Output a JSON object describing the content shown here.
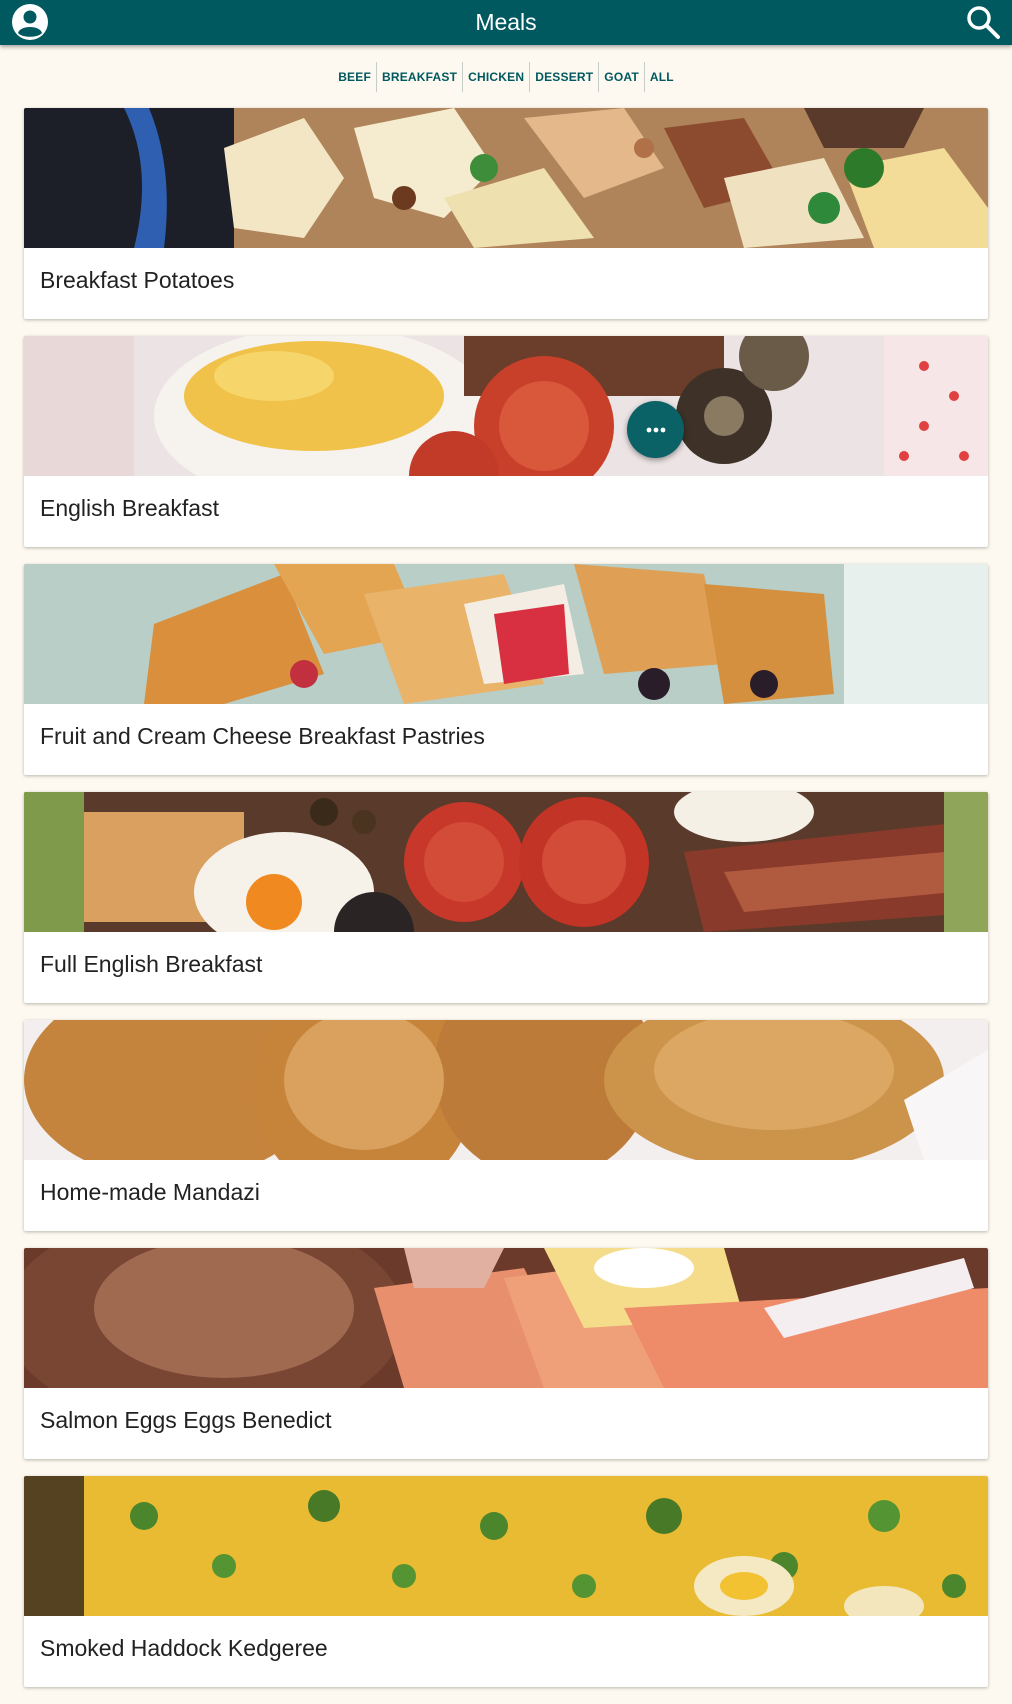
{
  "app": {
    "title": "Meals",
    "primary_color": "#00595f",
    "account_icon": "account-circle-icon",
    "search_icon": "search-icon"
  },
  "categories": [
    "BEEF",
    "BREAKFAST",
    "CHICKEN",
    "DESSERT",
    "GOAT",
    "ALL"
  ],
  "meals": [
    {
      "name": "Breakfast Potatoes"
    },
    {
      "name": "English Breakfast"
    },
    {
      "name": "Fruit and Cream Cheese Breakfast Pastries"
    },
    {
      "name": "Full English Breakfast"
    },
    {
      "name": "Home-made Mandazi"
    },
    {
      "name": "Salmon Eggs Eggs Benedict"
    },
    {
      "name": "Smoked Haddock Kedgeree"
    }
  ],
  "fab": {
    "icon": "more-horizontal-icon"
  }
}
